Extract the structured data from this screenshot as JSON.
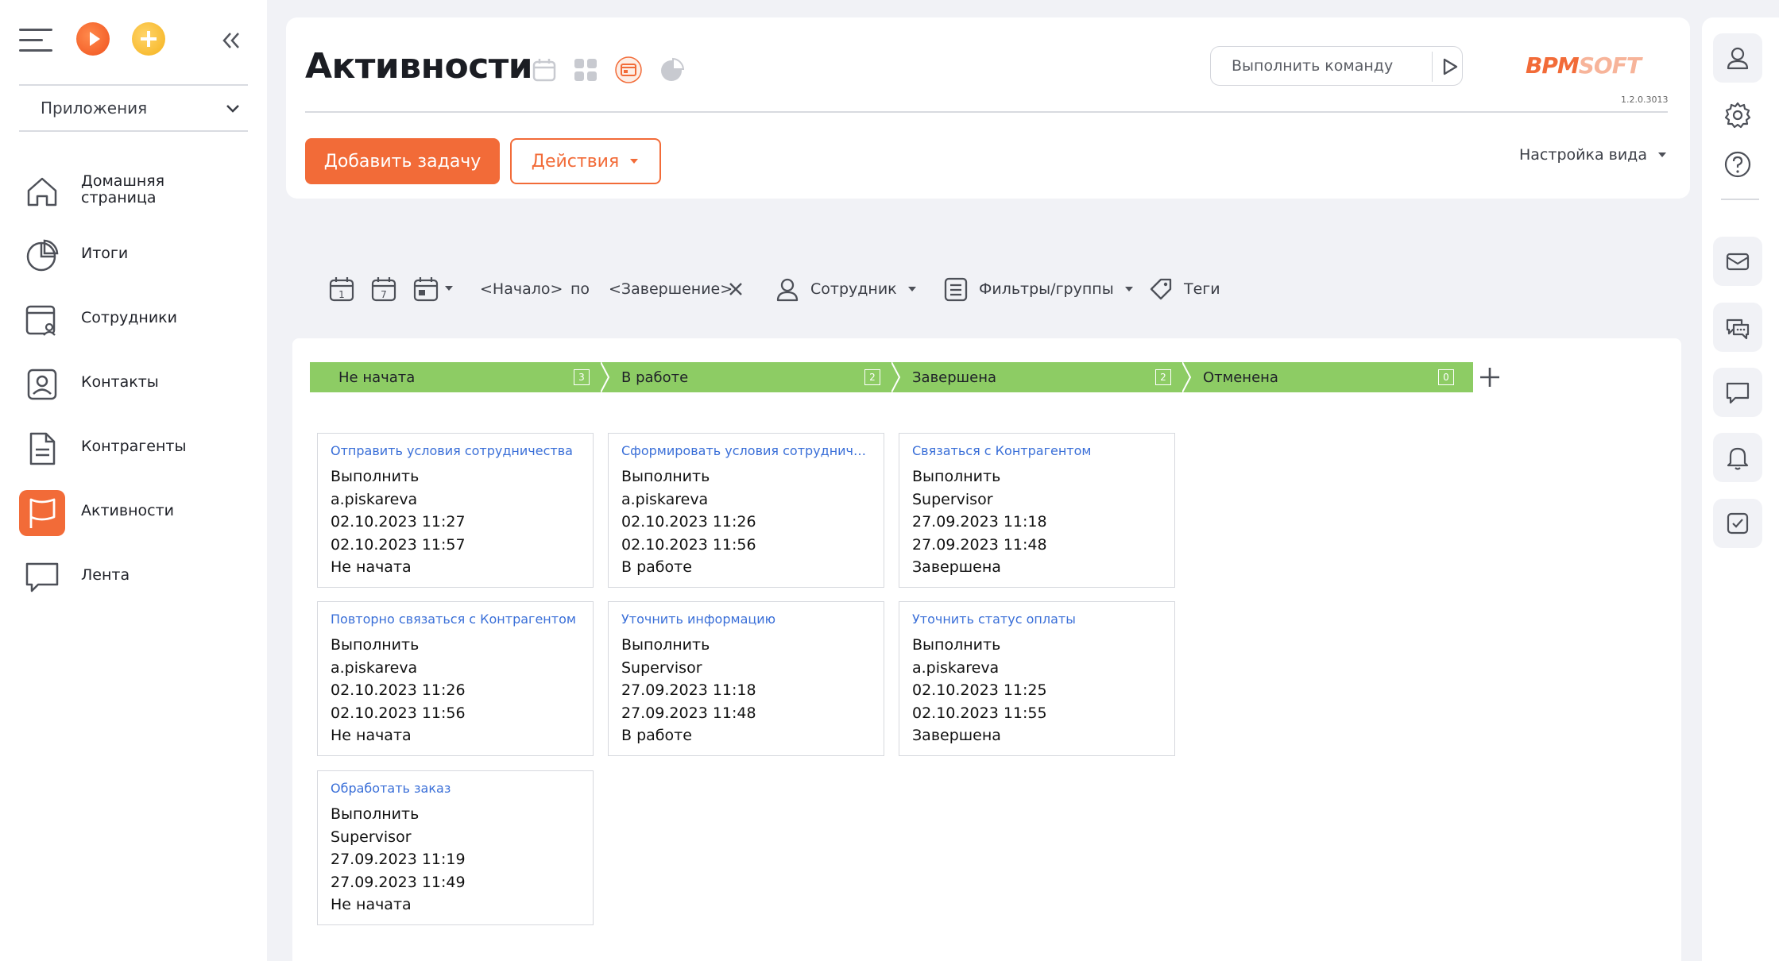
{
  "sidebar": {
    "apps_label": "Приложения",
    "items": [
      {
        "label": "Домашняя\nстраница",
        "icon": "home-icon"
      },
      {
        "label": "Итоги",
        "icon": "pie-chart-icon"
      },
      {
        "label": "Сотрудники",
        "icon": "employee-icon"
      },
      {
        "label": "Контакты",
        "icon": "contact-icon"
      },
      {
        "label": "Контрагенты",
        "icon": "document-icon"
      },
      {
        "label": "Активности",
        "icon": "flag-icon",
        "active": true
      },
      {
        "label": "Лента",
        "icon": "chat-icon"
      }
    ]
  },
  "header": {
    "title": "Активности",
    "command_placeholder": "Выполнить команду",
    "logo": {
      "part1": "BPM",
      "part2": "SOFT"
    },
    "version": "1.2.0.3013",
    "add_task_label": "Добавить задачу",
    "actions_label": "Действия",
    "view_settings_label": "Настройка вида"
  },
  "filters": {
    "start": "<Начало>",
    "by": "по",
    "end": "<Завершение>",
    "employee": "Сотрудник",
    "filters_groups": "Фильтры/группы",
    "tags": "Теги",
    "calendar_day_1": "1",
    "calendar_day_7": "7"
  },
  "stages": [
    {
      "name": "Не начата",
      "count": "3"
    },
    {
      "name": "В работе",
      "count": "2"
    },
    {
      "name": "Завершена",
      "count": "2"
    },
    {
      "name": "Отменена",
      "count": "0"
    }
  ],
  "cards": [
    {
      "title": "Отправить условия сотрудничества",
      "type": "Выполнить",
      "owner": "a.piskareva",
      "start": "02.10.2023 11:27",
      "end": "02.10.2023 11:57",
      "status": "Не начата"
    },
    {
      "title": "Сформировать условия сотрудничес...",
      "type": "Выполнить",
      "owner": "a.piskareva",
      "start": "02.10.2023 11:26",
      "end": "02.10.2023 11:56",
      "status": "В работе"
    },
    {
      "title": "Связаться с Контрагентом",
      "type": "Выполнить",
      "owner": "Supervisor",
      "start": "27.09.2023 11:18",
      "end": "27.09.2023 11:48",
      "status": "Завершена"
    },
    {
      "title": "Повторно связаться с Контрагентом",
      "type": "Выполнить",
      "owner": "a.piskareva",
      "start": "02.10.2023 11:26",
      "end": "02.10.2023 11:56",
      "status": "Не начата"
    },
    {
      "title": "Уточнить информацию",
      "type": "Выполнить",
      "owner": "Supervisor",
      "start": "27.09.2023 11:18",
      "end": "27.09.2023 11:48",
      "status": "В работе"
    },
    {
      "title": "Уточнить статус оплаты",
      "type": "Выполнить",
      "owner": "a.piskareva",
      "start": "02.10.2023 11:25",
      "end": "02.10.2023 11:55",
      "status": "Завершена"
    },
    {
      "title": "Обработать заказ",
      "type": "Выполнить",
      "owner": "Supervisor",
      "start": "27.09.2023 11:19",
      "end": "27.09.2023 11:49",
      "status": "Не начата"
    }
  ],
  "colors": {
    "accent": "#f26b38",
    "stage_green": "#8dcc64",
    "link_blue": "#3a6fd8"
  }
}
